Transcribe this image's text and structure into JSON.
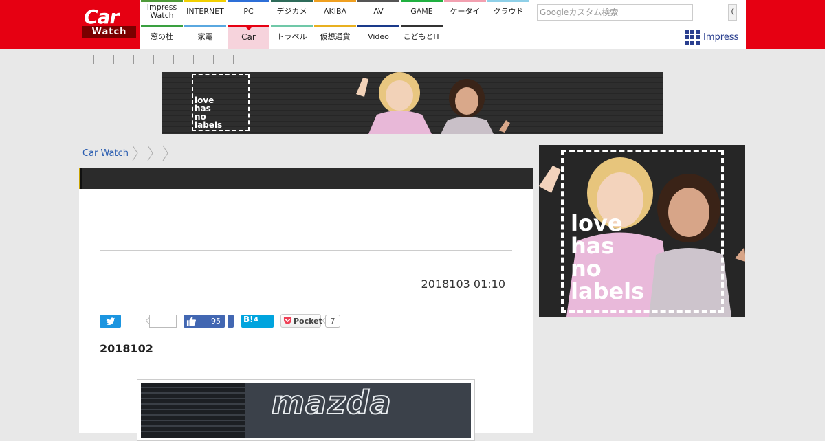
{
  "brand": {
    "logo_main": "Car",
    "logo_sub": "Watch"
  },
  "nav": {
    "row1": [
      {
        "label": "Impress Watch",
        "color": "#4f9a3a"
      },
      {
        "label": "INTERNET",
        "color": "#f2d000"
      },
      {
        "label": "PC",
        "color": "#2d6fd8"
      },
      {
        "label": "デジカメ",
        "color": "#2e6b5a"
      },
      {
        "label": "AKIBA",
        "color": "#f0a020"
      },
      {
        "label": "AV",
        "color": "#555555"
      },
      {
        "label": "GAME",
        "color": "#20b040"
      },
      {
        "label": "ケータイ",
        "color": "#f2a0b0"
      },
      {
        "label": "クラウド",
        "color": "#8fd0e8"
      }
    ],
    "row2": [
      {
        "label": "窓の杜",
        "color": "#3aa040"
      },
      {
        "label": "家電",
        "color": "#5aa8e0"
      },
      {
        "label": "Car",
        "color": "#e60012",
        "active": true
      },
      {
        "label": "トラベル",
        "color": "#70c8a8"
      },
      {
        "label": "仮想通貨",
        "color": "#e8b020"
      },
      {
        "label": "Video",
        "color": "#1a3a8a"
      },
      {
        "label": "こどもとIT",
        "color": "#333333"
      }
    ]
  },
  "search": {
    "placeholder": "Googleカスタム検索",
    "button_label": "("
  },
  "impress_link": "Impress",
  "ad_top": {
    "words": [
      "love",
      "has",
      "no",
      "labels"
    ]
  },
  "ad_side": {
    "words": [
      "love",
      "has",
      "no",
      "labels"
    ]
  },
  "breadcrumb": {
    "home": "Car Watch"
  },
  "article": {
    "title": "",
    "date": "2018103 01:10",
    "lead": "2018102",
    "photo_brand": "mazda"
  },
  "social": {
    "twitter_count": "",
    "facebook_count": "95",
    "hatena_label": "B!",
    "hatena_count": "4",
    "pocket_label": "Pocket",
    "pocket_count": "7"
  },
  "colors": {
    "brand_red": "#e60012",
    "link_blue": "#2a5db0",
    "title_bar": "#2b2b2b",
    "impress_blue": "#2a3f8f"
  }
}
